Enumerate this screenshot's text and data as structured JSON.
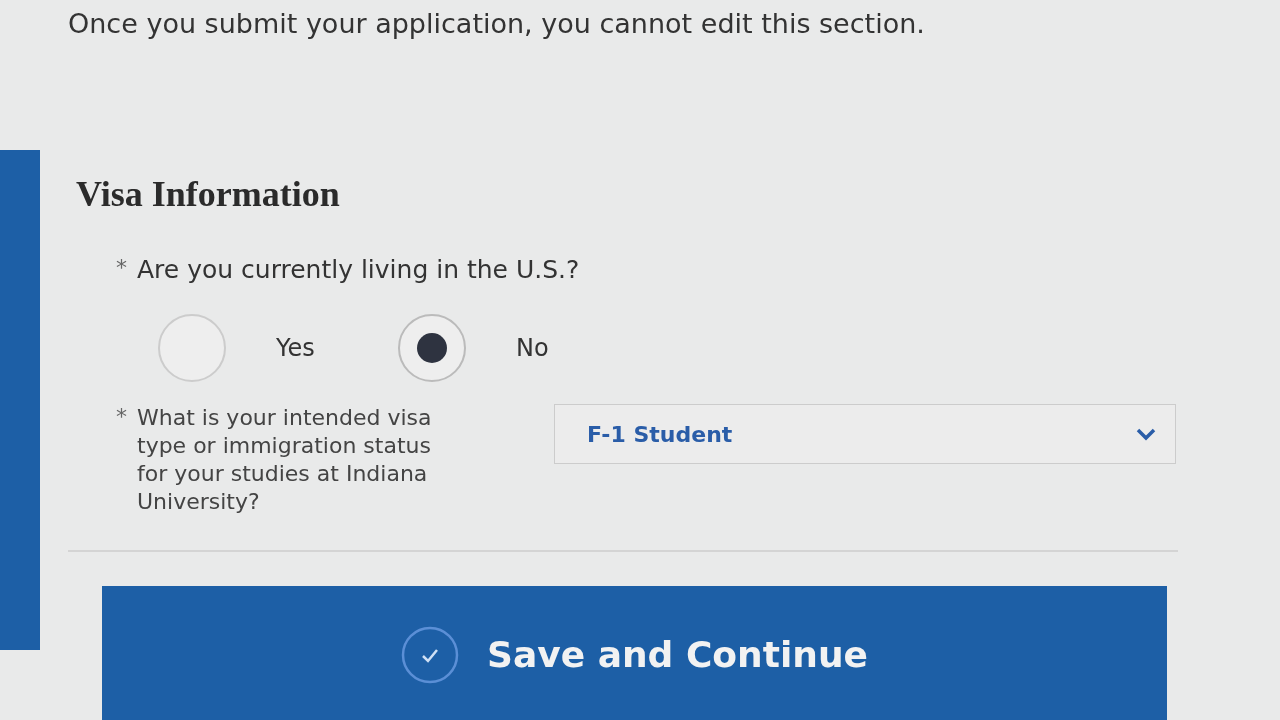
{
  "notice": "Once you submit your application, you cannot edit this section.",
  "section_title": "Visa Information",
  "questions": [
    {
      "kind": "radio",
      "required_mark": "*",
      "label": "Are you currently living in the U.S.?",
      "options": [
        {
          "label": "Yes",
          "selected": false
        },
        {
          "label": "No",
          "selected": true
        }
      ]
    },
    {
      "kind": "select",
      "required_mark": "*",
      "label": "What is your intended visa type or immigration status for your studies at Indiana University?",
      "value": "F-1 Student"
    }
  ],
  "save_button": {
    "label": "Save and Continue"
  }
}
